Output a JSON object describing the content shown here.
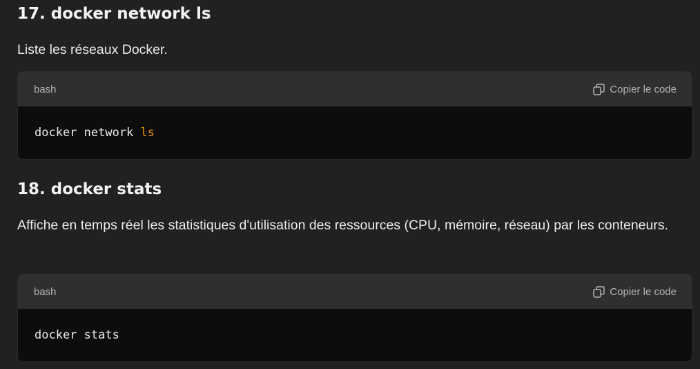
{
  "sections": [
    {
      "heading": "17. docker network ls",
      "description": "Liste les réseaux Docker.",
      "code": {
        "language": "bash",
        "copy_label": "Copier le code",
        "command_plain": "docker network ",
        "command_highlight": "ls"
      }
    },
    {
      "heading": "18. docker stats",
      "description": "Affiche en temps réel les statistiques d'utilisation des ressources (CPU, mémoire, réseau) par les conteneurs.",
      "code": {
        "language": "bash",
        "copy_label": "Copier le code",
        "command_plain": "docker stats",
        "command_highlight": ""
      }
    }
  ],
  "colors": {
    "background": "#212121",
    "code_header": "#2f2f2f",
    "code_body": "#0d0d0d",
    "keyword": "#e9950c"
  }
}
